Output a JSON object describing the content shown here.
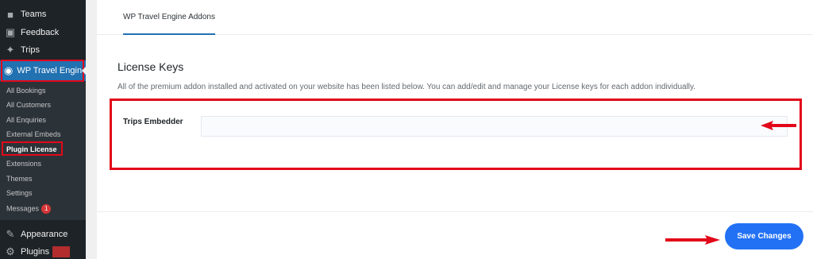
{
  "sidebar": {
    "items": [
      {
        "label": "Teams",
        "icon": "teams-icon"
      },
      {
        "label": "Feedback",
        "icon": "feedback-icon"
      },
      {
        "label": "Trips",
        "icon": "trips-icon"
      },
      {
        "label": "WP Travel Engine",
        "icon": "travel-engine-icon"
      }
    ],
    "submenu": [
      {
        "label": "All Bookings"
      },
      {
        "label": "All Customers"
      },
      {
        "label": "All Enquiries"
      },
      {
        "label": "External Embeds"
      },
      {
        "label": "Plugin License"
      },
      {
        "label": "Extensions"
      },
      {
        "label": "Themes"
      },
      {
        "label": "Settings"
      },
      {
        "label": "Messages",
        "badge": "1"
      }
    ],
    "bottom": [
      {
        "label": "Appearance",
        "icon": "appearance-icon"
      },
      {
        "label": "Plugins",
        "icon": "plugins-icon"
      }
    ]
  },
  "tabs": [
    {
      "label": "WP Travel Engine Addons"
    }
  ],
  "main": {
    "title": "License Keys",
    "description": "All of the premium addon installed and activated on your website has been listed below. You can add/edit and manage your License keys for each addon individually.",
    "field_label": "Trips Embedder",
    "field_value": "",
    "save_label": "Save Changes"
  },
  "colors": {
    "sidebar_bg": "#1d2327",
    "accent": "#2271b1",
    "annotation_red": "#e2081a",
    "button_blue": "#2271f5"
  }
}
